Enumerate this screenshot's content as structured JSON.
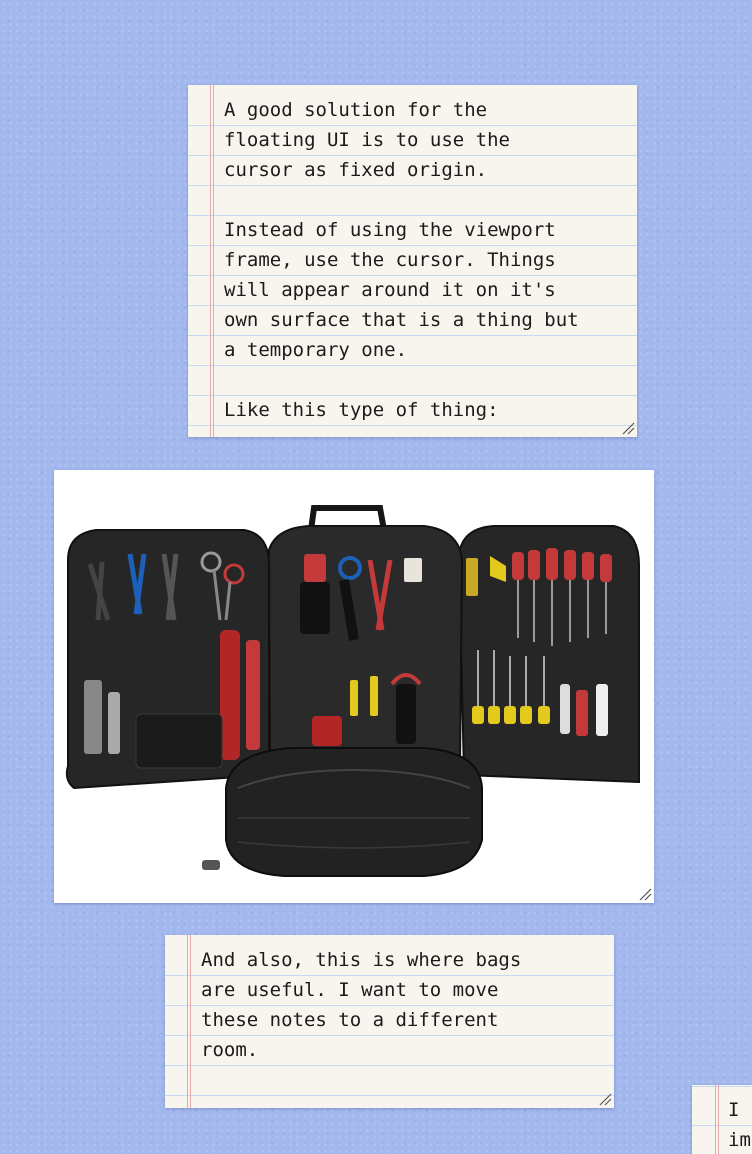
{
  "notes": [
    {
      "id": "note-cursor-origin",
      "text": "A good solution for the\nfloating UI is to use the\ncursor as fixed origin.\n\nInstead of using the viewport\nframe, use the cursor. Things\nwill appear around it on it's\nown surface that is a thing but\na temporary one.\n\nLike this type of thing:"
    },
    {
      "id": "note-bags",
      "text": "And also, this is where bags\nare useful. I want to move\nthese notes to a different\nroom."
    },
    {
      "id": "note-partial",
      "text": "I \nim"
    }
  ],
  "image_card": {
    "subject": "open tool backpack with three panels of hand tools"
  },
  "colors": {
    "background": "#a3b9ee",
    "note_paper": "#f8f5ef",
    "rule_line": "#c9d8f3",
    "margin_line": "#e8a7a7",
    "text": "#1b1b1b"
  },
  "icons": {
    "resize": "resize-handle-icon"
  }
}
